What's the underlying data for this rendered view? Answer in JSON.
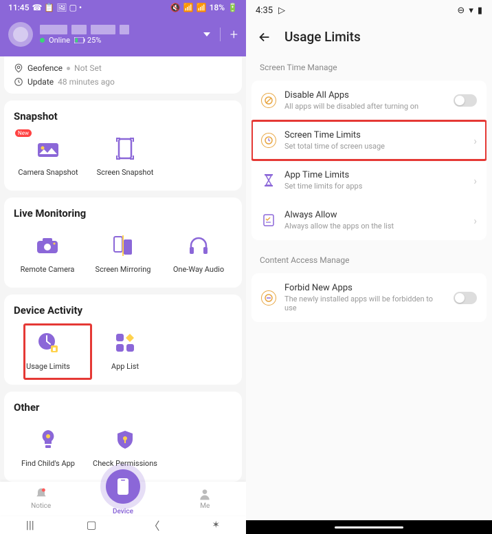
{
  "left": {
    "status": {
      "time": "11:45",
      "battery": "18%"
    },
    "header": {
      "online_label": "Online",
      "battery_label": "25%"
    },
    "info": {
      "geofence_label": "Geofence",
      "geofence_status": "Not Set",
      "update_label": "Update",
      "update_value": "48 minutes ago"
    },
    "sections": {
      "snapshot": {
        "title": "Snapshot",
        "items": [
          "Camera Snapshot",
          "Screen Snapshot"
        ]
      },
      "live": {
        "title": "Live Monitoring",
        "items": [
          "Remote Camera",
          "Screen Mirroring",
          "One-Way Audio"
        ]
      },
      "activity": {
        "title": "Device Activity",
        "items": [
          "Usage Limits",
          "App List"
        ]
      },
      "other": {
        "title": "Other",
        "items": [
          "Find Child's App",
          "Check Permissions"
        ]
      }
    },
    "new_badge": "New",
    "nav": {
      "notice": "Notice",
      "device": "Device",
      "me": "Me"
    }
  },
  "right": {
    "status": {
      "time": "4:35"
    },
    "title": "Usage Limits",
    "section1_label": "Screen Time Manage",
    "section2_label": "Content Access Manage",
    "rows": {
      "disable": {
        "title": "Disable All Apps",
        "sub": "All apps will be disabled after turning on"
      },
      "screen_time": {
        "title": "Screen Time Limits",
        "sub": "Set total time of screen usage"
      },
      "app_time": {
        "title": "App Time Limits",
        "sub": "Set time limits for apps"
      },
      "always": {
        "title": "Always Allow",
        "sub": "Always allow the apps on the list"
      },
      "forbid": {
        "title": "Forbid New Apps",
        "sub": "The newly installed apps will be forbidden to use"
      }
    }
  }
}
